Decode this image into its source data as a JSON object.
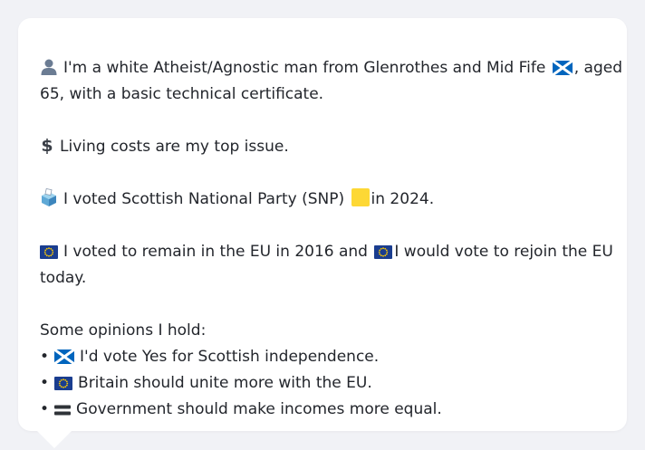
{
  "bio": {
    "line1": "I'm a white Atheist/Agnostic man from Glenrothes and Mid Fife",
    "line1_suffix": ", aged",
    "line2": "65, with a basic technical certificate."
  },
  "issue": {
    "text": "Living costs are my top issue."
  },
  "vote2024": {
    "text_before": "I voted Scottish National Party (SNP)",
    "text_after": "in 2024.",
    "party_color": "#fdd835"
  },
  "eu": {
    "text_before": "I voted to remain in the EU in 2016 and",
    "text_after": "I would vote to rejoin the EU",
    "line2": "today."
  },
  "opinions": {
    "heading": "Some opinions I hold:",
    "bullet": "•",
    "items": [
      {
        "icon": "scotland-flag-icon",
        "text": "I'd vote Yes for Scottish independence."
      },
      {
        "icon": "eu-flag-icon",
        "text": "Britain should unite more with the EU."
      },
      {
        "icon": "equals-icon",
        "text": "Government should make incomes more equal."
      }
    ]
  },
  "colors": {
    "background": "#f1f2f6",
    "card": "#ffffff",
    "text": "#23262c",
    "scotland_blue": "#0065bd",
    "eu_blue": "#1a3d8f",
    "eu_star": "#ffcc00"
  }
}
